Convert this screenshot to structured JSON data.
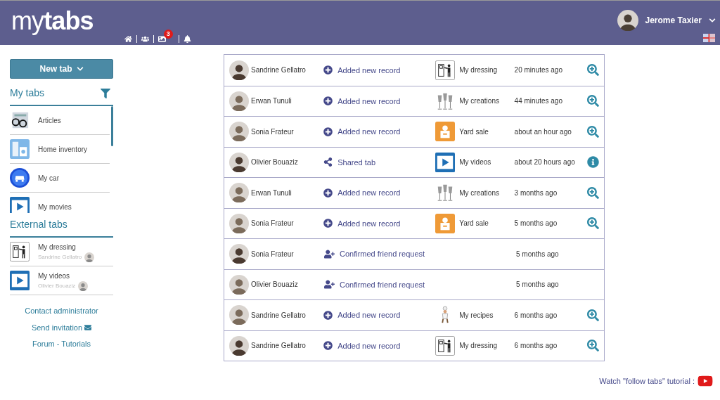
{
  "header": {
    "logo": "my**tabs**",
    "nav": [
      {
        "kind": "home"
      },
      {
        "kind": "friends"
      },
      {
        "kind": "pictures",
        "badge": "3"
      },
      {
        "kind": "bell"
      }
    ],
    "user": {
      "name": "Jerome Taxier"
    }
  },
  "sidebar": {
    "new_tab": "New tab",
    "my_tabs": {
      "title": "My tabs",
      "items": [
        {
          "label": "Articles",
          "kind": "articles"
        },
        {
          "label": "Home inventory",
          "kind": "inventory"
        },
        {
          "label": "My car",
          "kind": "car"
        },
        {
          "label": "My movies",
          "kind": "videos"
        }
      ]
    },
    "external_tabs": {
      "title": "External tabs",
      "items": [
        {
          "label": "My dressing",
          "owner": "Sandrine Gellatro",
          "kind": "dressing"
        },
        {
          "label": "My videos",
          "owner": "Olivier Bouaziz",
          "kind": "videos"
        }
      ]
    },
    "links": [
      {
        "label": "Contact administrator",
        "kind": "plain"
      },
      {
        "label": "Send invitation",
        "kind": "mail"
      },
      {
        "label": "Forum - Tutorials",
        "kind": "plain"
      }
    ]
  },
  "activity": [
    {
      "user": "Sandrine Gellatro",
      "kind": "add",
      "action": "Added new record",
      "tab": {
        "label": "My dressing",
        "kind": "dressing"
      },
      "time": "20 minutes ago",
      "button": {
        "kind": "zoom"
      }
    },
    {
      "user": "Erwan Tunuli",
      "kind": "add",
      "action": "Added new record",
      "tab": {
        "label": "My creations",
        "kind": "creations"
      },
      "time": "44 minutes ago",
      "button": {
        "kind": "zoom"
      }
    },
    {
      "user": "Sonia Frateur",
      "kind": "add",
      "action": "Added new record",
      "tab": {
        "label": "Yard sale",
        "kind": "yardsale"
      },
      "time": "about an hour ago",
      "button": {
        "kind": "zoom"
      }
    },
    {
      "user": "Olivier Bouaziz",
      "kind": "share",
      "action": "Shared tab",
      "tab": {
        "label": "My videos",
        "kind": "videos"
      },
      "time": "about 20 hours ago",
      "button": {
        "kind": "info"
      }
    },
    {
      "user": "Erwan Tunuli",
      "kind": "add",
      "action": "Added new record",
      "tab": {
        "label": "My creations",
        "kind": "creations"
      },
      "time": "3 months ago",
      "button": {
        "kind": "zoom"
      }
    },
    {
      "user": "Sonia Frateur",
      "kind": "add",
      "action": "Added new record",
      "tab": {
        "label": "Yard sale",
        "kind": "yardsale"
      },
      "time": "5 months ago",
      "button": {
        "kind": "zoom"
      }
    },
    {
      "user": "Sonia Frateur",
      "kind": "friend",
      "action": "Confirmed friend request",
      "time": "5 months ago"
    },
    {
      "user": "Olivier Bouaziz",
      "kind": "friend",
      "action": "Confirmed friend request",
      "time": "5 months ago"
    },
    {
      "user": "Sandrine Gellatro",
      "kind": "add",
      "action": "Added new record",
      "tab": {
        "label": "My recipes",
        "kind": "recipes"
      },
      "time": "6 months ago",
      "button": {
        "kind": "zoom"
      }
    },
    {
      "user": "Sandrine Gellatro",
      "kind": "add",
      "action": "Added new record",
      "tab": {
        "label": "My dressing",
        "kind": "dressing"
      },
      "time": "6 months ago",
      "button": {
        "kind": "zoom"
      }
    }
  ],
  "footer": {
    "tutorial": "Watch \"follow tabs\" tutorial :"
  }
}
